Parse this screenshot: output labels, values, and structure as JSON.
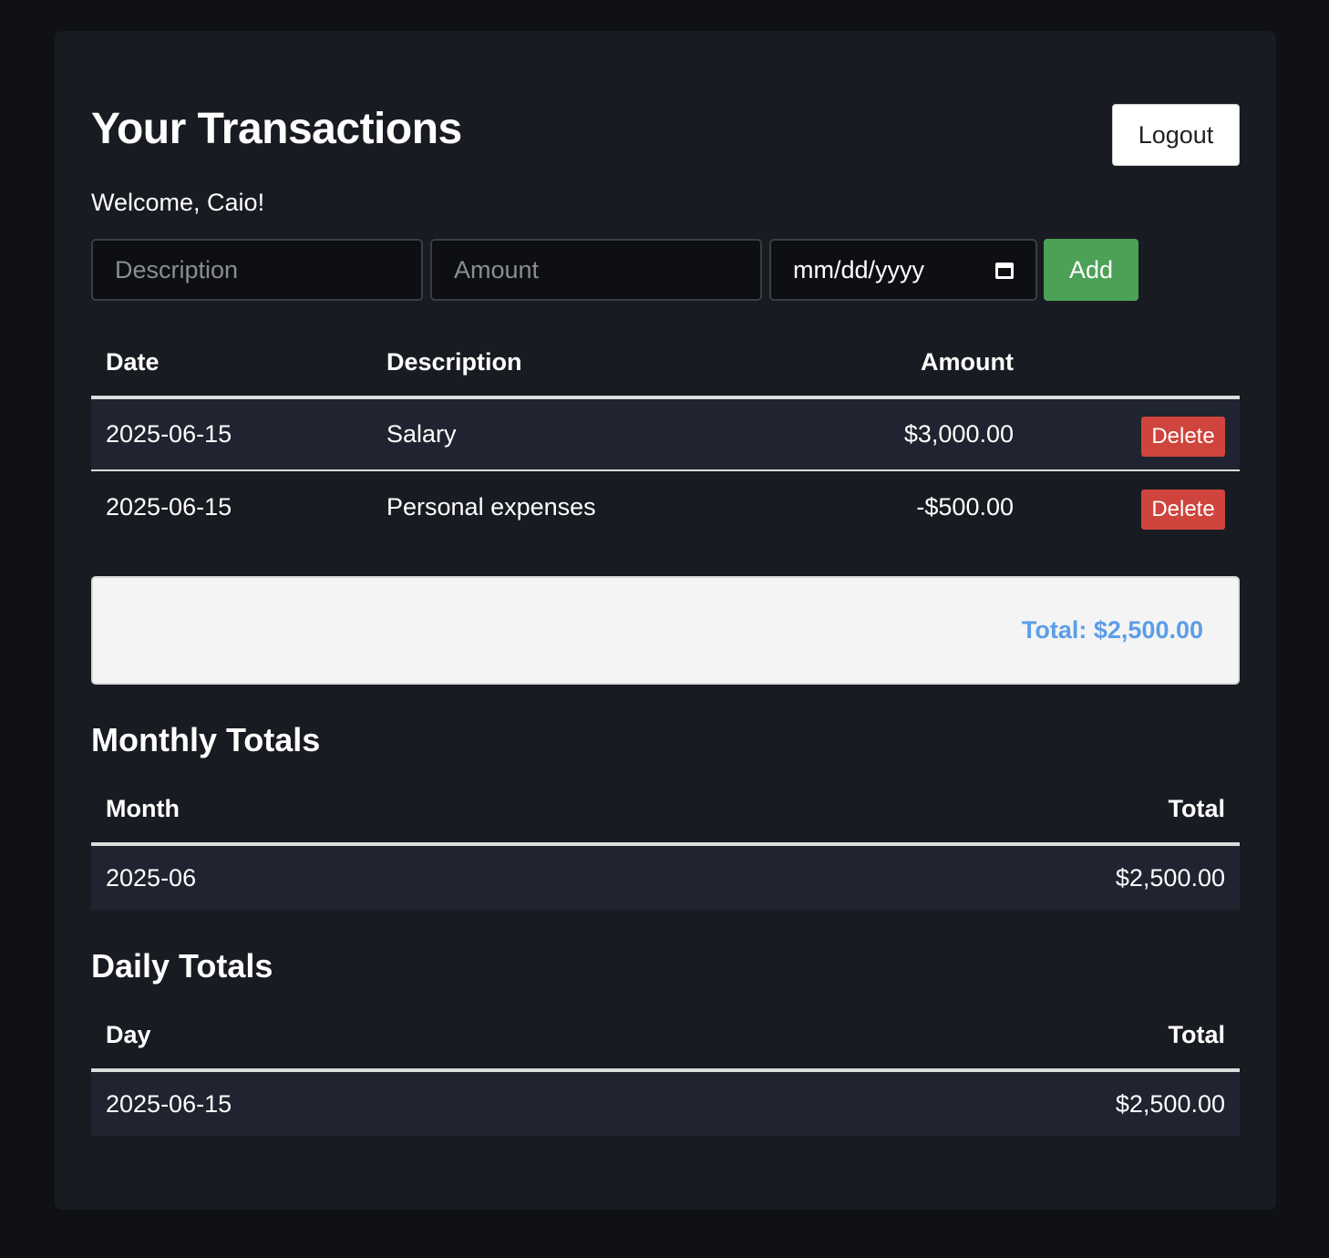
{
  "header": {
    "title": "Your Transactions",
    "logout_label": "Logout",
    "welcome": "Welcome, Caio!"
  },
  "form": {
    "description_placeholder": "Description",
    "amount_placeholder": "Amount",
    "date_placeholder": "mm/dd/yyyy",
    "add_label": "Add"
  },
  "transactions": {
    "columns": {
      "date": "Date",
      "description": "Description",
      "amount": "Amount"
    },
    "delete_label": "Delete",
    "rows": [
      {
        "date": "2025-06-15",
        "description": "Salary",
        "amount": "$3,000.00"
      },
      {
        "date": "2025-06-15",
        "description": "Personal expenses",
        "amount": "-$500.00"
      }
    ]
  },
  "total": {
    "text": "Total: $2,500.00"
  },
  "monthly": {
    "title": "Monthly Totals",
    "columns": {
      "month": "Month",
      "total": "Total"
    },
    "rows": [
      {
        "month": "2025-06",
        "total": "$2,500.00"
      }
    ]
  },
  "daily": {
    "title": "Daily Totals",
    "columns": {
      "day": "Day",
      "total": "Total"
    },
    "rows": [
      {
        "day": "2025-06-15",
        "total": "$2,500.00"
      }
    ]
  },
  "colors": {
    "background": "#0f1115",
    "card": "#191b22",
    "add_button": "#4ca156",
    "delete_button": "#d0443e",
    "total_text": "#5b9ee8"
  },
  "icons": {
    "date_picker": "calendar-icon"
  }
}
